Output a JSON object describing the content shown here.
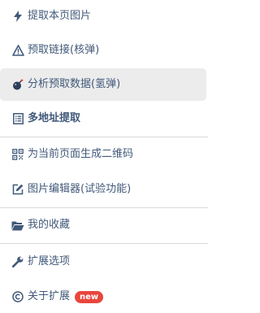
{
  "menu": {
    "items": [
      {
        "label": "提取本页图片"
      },
      {
        "label": "预取链接(核弹)"
      },
      {
        "label": "分析预取数据(氢弹)"
      },
      {
        "label": "多地址提取"
      },
      {
        "label": "为当前页面生成二维码"
      },
      {
        "label": "图片编辑器(试验功能)"
      },
      {
        "label": "我的收藏"
      },
      {
        "label": "扩展选项"
      },
      {
        "label": "关于扩展",
        "badge": "new"
      }
    ]
  },
  "colors": {
    "text": "#41597a",
    "active_background": "#ececec",
    "divider": "#d9d9d9",
    "badge": "#e8463c"
  }
}
